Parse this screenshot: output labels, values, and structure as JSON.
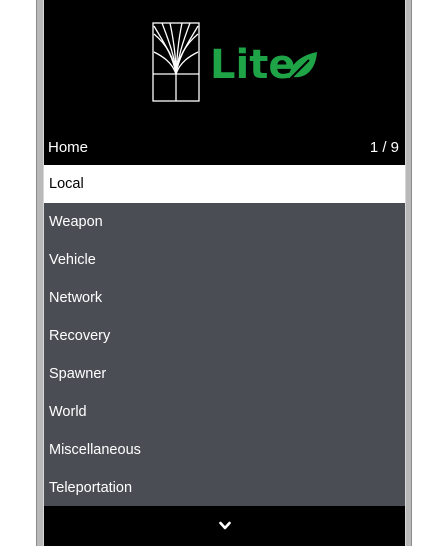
{
  "header": {
    "logo_text": "Lite",
    "logo_color": "#1fa347"
  },
  "subheader": {
    "title": "Home",
    "counter": "1 / 9"
  },
  "menu": {
    "items": [
      {
        "label": "Local",
        "selected": true
      },
      {
        "label": "Weapon"
      },
      {
        "label": "Vehicle"
      },
      {
        "label": "Network"
      },
      {
        "label": "Recovery"
      },
      {
        "label": "Spawner"
      },
      {
        "label": "World"
      },
      {
        "label": "Miscellaneous"
      },
      {
        "label": "Teleportation"
      }
    ]
  },
  "footer": {
    "icon": "chevron-down-icon"
  },
  "colors": {
    "background": "#000000",
    "list_background": "#4a4d54",
    "selected_background": "#ffffff",
    "selected_text": "#000000",
    "text": "#ffffff"
  }
}
